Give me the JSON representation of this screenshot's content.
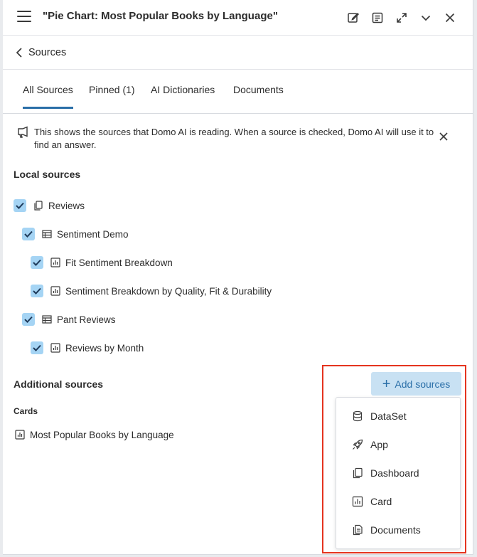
{
  "header": {
    "title": "\"Pie Chart: Most Popular Books by Language\"",
    "icons": [
      "hamburger-icon",
      "edit-icon",
      "notes-icon",
      "expand-icon",
      "chevron-down-icon",
      "close-icon"
    ]
  },
  "subheader": {
    "title": "Sources"
  },
  "tabs": [
    {
      "label": "All Sources",
      "active": true
    },
    {
      "label": "Pinned (1)",
      "active": false
    },
    {
      "label": "AI Dictionaries",
      "active": false
    },
    {
      "label": "Documents",
      "active": false
    }
  ],
  "info": {
    "text": "This shows the sources that Domo AI is reading. When a source is checked, Domo AI will use it to find an answer."
  },
  "local": {
    "title": "Local sources",
    "items": [
      {
        "label": "Reviews",
        "icon": "dashboard-icon",
        "checked": true
      },
      {
        "label": "Sentiment Demo",
        "icon": "dataset-table-icon",
        "checked": true
      },
      {
        "label": "Fit Sentiment Breakdown",
        "icon": "card-chart-icon",
        "checked": true
      },
      {
        "label": "Sentiment Breakdown by Quality, Fit & Durability",
        "icon": "card-chart-icon",
        "checked": true
      },
      {
        "label": "Pant Reviews",
        "icon": "dataset-table-icon",
        "checked": true
      },
      {
        "label": "Reviews by Month",
        "icon": "card-chart-icon",
        "checked": true
      }
    ]
  },
  "additional": {
    "title": "Additional sources",
    "cards_label": "Cards",
    "cards": [
      {
        "label": "Most Popular Books by Language",
        "icon": "card-chart-icon"
      }
    ]
  },
  "add_button": {
    "label": "Add sources"
  },
  "menu": {
    "items": [
      {
        "label": "DataSet",
        "icon": "database-icon"
      },
      {
        "label": "App",
        "icon": "rocket-icon"
      },
      {
        "label": "Dashboard",
        "icon": "dashboard-icon"
      },
      {
        "label": "Card",
        "icon": "card-chart-icon"
      },
      {
        "label": "Documents",
        "icon": "document-icon"
      }
    ]
  },
  "colors": {
    "accent": "#2a6fa8",
    "checkbox": "#a5d4f4",
    "add_button_bg": "#c8e1f3",
    "highlight": "#e5341f"
  }
}
